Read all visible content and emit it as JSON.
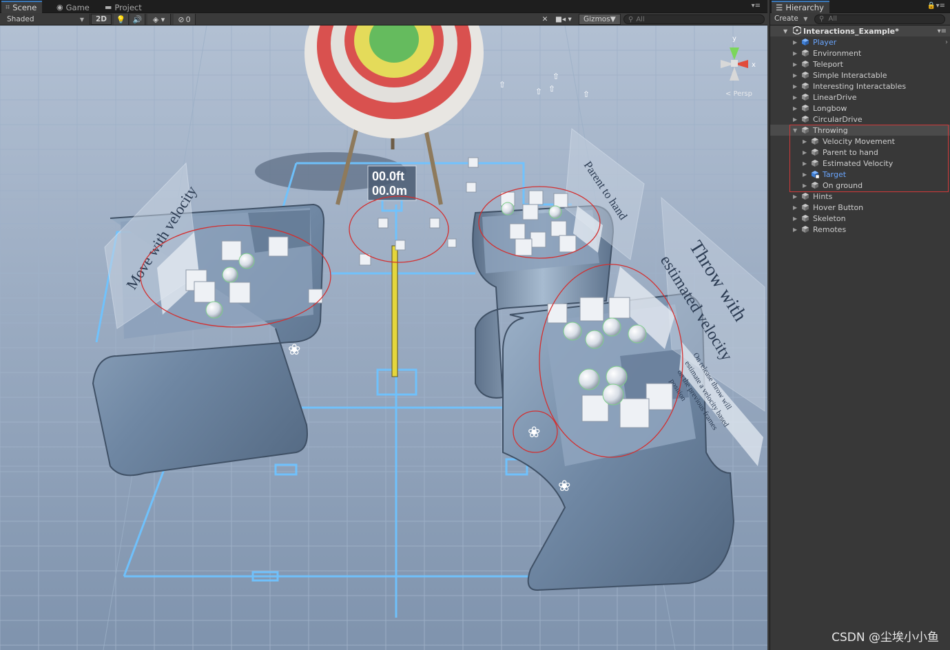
{
  "scene_panel": {
    "tabs": [
      {
        "label": "Scene",
        "icon": "grid-icon"
      },
      {
        "label": "Game",
        "icon": "game-controller-icon"
      },
      {
        "label": "Project",
        "icon": "folder-icon"
      }
    ],
    "toolbar": {
      "shading_mode": "Shaded",
      "mode_2d": "2D",
      "lighting_icon": "light-bulb-icon",
      "audio_icon": "speaker-icon",
      "effects_icon": "effects-icon",
      "hidden_count": "0",
      "tools_icon": "tools-icon",
      "camera_icon": "camera-icon",
      "gizmos_label": "Gizmos",
      "search_placeholder": "All"
    },
    "viewport": {
      "score_line_1": "00.0ft",
      "score_line_2": "00.0m",
      "sign_left": "Move with velocity",
      "sign_top_right": "Parent to hand",
      "sign_right_1": "Throw with",
      "sign_right_2": "estimated velocity",
      "sign_right_text_1": "On release throw will",
      "sign_right_text_2": "estimate a velocity based",
      "sign_right_text_3": "on the previous frames",
      "sign_right_text_4": "position",
      "gizmo_axis_y": "y",
      "gizmo_axis_x": "x",
      "persp_label": "< Persp",
      "colors": {
        "sky": "#a3b3c8",
        "floor": "#8fa3bd",
        "highlight": "#d32f2f",
        "hologram": "#6ec3ff"
      }
    }
  },
  "hierarchy": {
    "tab_label": "Hierarchy",
    "create_label": "Create",
    "search_placeholder": "All",
    "scene_name": "Interactions_Example*",
    "items": [
      {
        "label": "Player",
        "depth": 0,
        "expanded": false,
        "color": "blue",
        "icon": "prefab-cube-icon"
      },
      {
        "label": "Environment",
        "depth": 0,
        "expanded": false,
        "icon": "gameobject-cube-icon"
      },
      {
        "label": "Teleport",
        "depth": 0,
        "expanded": false,
        "icon": "gameobject-cube-icon"
      },
      {
        "label": "Simple Interactable",
        "depth": 0,
        "expanded": false,
        "icon": "gameobject-cube-icon"
      },
      {
        "label": "Interesting Interactables",
        "depth": 0,
        "expanded": false,
        "icon": "gameobject-cube-icon"
      },
      {
        "label": "LinearDrive",
        "depth": 0,
        "expanded": false,
        "icon": "gameobject-cube-icon"
      },
      {
        "label": "Longbow",
        "depth": 0,
        "expanded": false,
        "icon": "gameobject-cube-icon"
      },
      {
        "label": "CircularDrive",
        "depth": 0,
        "expanded": false,
        "icon": "gameobject-cube-icon"
      },
      {
        "label": "Throwing",
        "depth": 0,
        "expanded": true,
        "icon": "gameobject-cube-icon"
      },
      {
        "label": "Velocity Movement",
        "depth": 1,
        "expanded": false,
        "icon": "gameobject-cube-icon"
      },
      {
        "label": "Parent to hand",
        "depth": 1,
        "expanded": false,
        "icon": "gameobject-cube-icon"
      },
      {
        "label": "Estimated Velocity",
        "depth": 1,
        "expanded": false,
        "icon": "gameobject-cube-icon"
      },
      {
        "label": "Target",
        "depth": 1,
        "expanded": false,
        "color": "blue",
        "icon": "prefab-modified-icon"
      },
      {
        "label": "On ground",
        "depth": 1,
        "expanded": false,
        "icon": "gameobject-cube-icon"
      },
      {
        "label": "Hints",
        "depth": 0,
        "expanded": false,
        "icon": "gameobject-cube-icon"
      },
      {
        "label": "Hover Button",
        "depth": 0,
        "expanded": false,
        "icon": "gameobject-cube-icon"
      },
      {
        "label": "Skeleton",
        "depth": 0,
        "expanded": false,
        "icon": "gameobject-cube-icon"
      },
      {
        "label": "Remotes",
        "depth": 0,
        "expanded": false,
        "icon": "gameobject-cube-icon"
      }
    ]
  },
  "watermark": "CSDN @尘埃小小鱼"
}
